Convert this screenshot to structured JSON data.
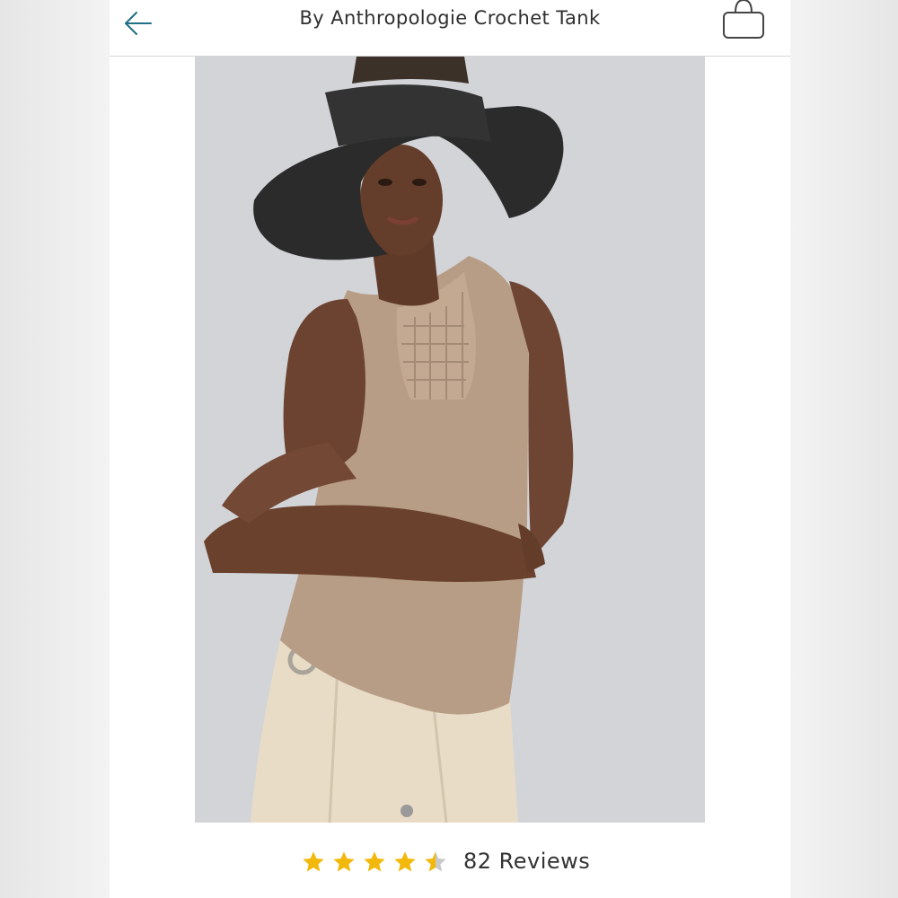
{
  "header": {
    "title": "By Anthropologie Crochet Tank",
    "back_icon": "arrow-left-icon",
    "bag_icon": "shopping-bag-icon",
    "accent_color": "#1f6f86"
  },
  "product_image": {
    "subject": "product-photo"
  },
  "rating": {
    "stars_value": 4.5,
    "stars_max": 5,
    "star_color": "#f2b90c",
    "reviews_label": "82 Reviews"
  }
}
